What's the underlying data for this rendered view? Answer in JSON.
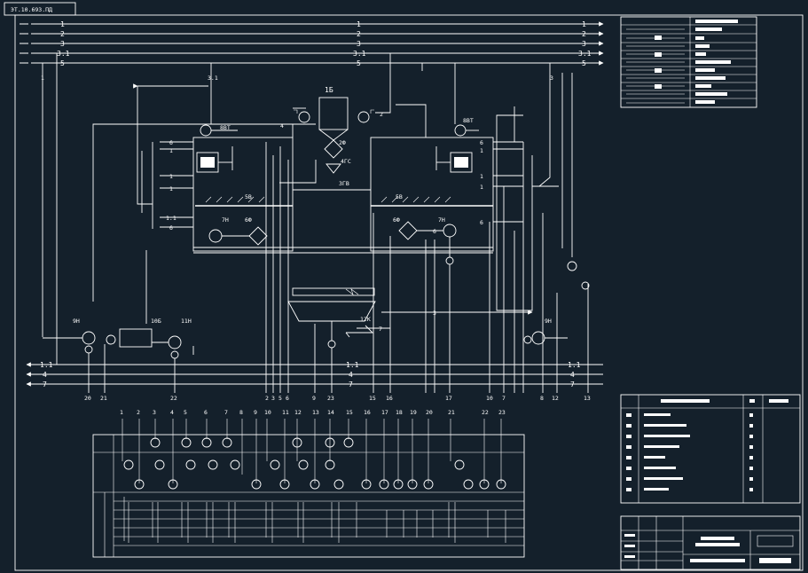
{
  "stamp": "ЭТ.10.693.ПД",
  "bus_lines": {
    "left_top": [
      "1",
      "2",
      "3",
      "3.1",
      "5"
    ],
    "right_top": [
      "1",
      "2",
      "3",
      "3.1",
      "5"
    ],
    "bottom": [
      "1.1",
      "4",
      "7"
    ]
  },
  "equipment": {
    "tank_1b": "1Б",
    "fan_8vt_left": "8ВТ",
    "fan_8vt_right": "8ВТ",
    "filter_2f": "2Ф",
    "dryer_4gs": "4ГС",
    "valve_3gv": "3ГВ",
    "heater_5v_left": "5В",
    "heater_5v_right": "5В",
    "pump_7n_left": "7Н",
    "pump_7n_right": "7Н",
    "filter_6f_left": "6Ф",
    "filter_6f_right": "6Ф",
    "pump_9n_left": "9Н",
    "pump_9n_right": "9Н",
    "tank_10b": "10Б",
    "pump_11n": "11Н",
    "unit_12k": "12К"
  },
  "stream_labels": {
    "left_side": [
      "6",
      "1",
      "1",
      "1",
      "1.1",
      "6"
    ],
    "right_side": [
      "6",
      "1",
      "1",
      "1",
      "6"
    ],
    "mid": [
      "3",
      "4",
      "6",
      "7",
      "1",
      "2",
      "3",
      "3.1"
    ]
  },
  "bottom_numbers": [
    "20",
    "21",
    "22",
    "2",
    "3",
    "5",
    "6",
    "9",
    "23",
    "15",
    "16",
    "17",
    "10",
    "7",
    "8",
    "12",
    "13"
  ],
  "instrument_columns": [
    "1",
    "2",
    "3",
    "4",
    "5",
    "6",
    "7",
    "8",
    "9",
    "10",
    "11",
    "12",
    "13",
    "14",
    "15",
    "16",
    "17",
    "18",
    "19",
    "20",
    "21",
    "22",
    "23"
  ],
  "colors": {
    "background": "#14202b",
    "lines": "#ffffff"
  }
}
